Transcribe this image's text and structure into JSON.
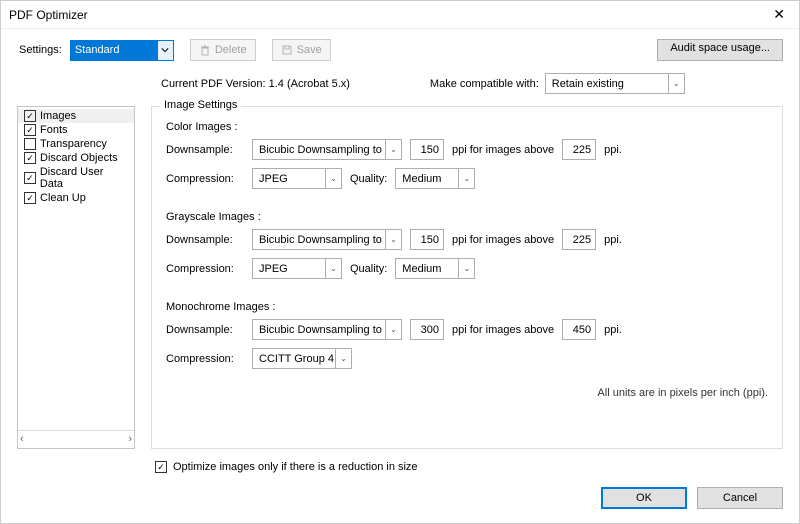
{
  "window": {
    "title": "PDF Optimizer"
  },
  "toolbar": {
    "settings_label": "Settings:",
    "settings_value": "Standard",
    "delete_label": "Delete",
    "save_label": "Save",
    "audit_label": "Audit space usage..."
  },
  "info": {
    "current_version": "Current PDF Version: 1.4 (Acrobat 5.x)",
    "compat_label": "Make compatible with:",
    "compat_value": "Retain existing"
  },
  "sidebar": {
    "items": [
      {
        "label": "Images",
        "checked": true,
        "selected": true
      },
      {
        "label": "Fonts",
        "checked": true
      },
      {
        "label": "Transparency",
        "checked": false
      },
      {
        "label": "Discard Objects",
        "checked": true
      },
      {
        "label": "Discard User Data",
        "checked": true
      },
      {
        "label": "Clean Up",
        "checked": true
      }
    ]
  },
  "panel": {
    "group_title": "Image Settings",
    "color": {
      "title": "Color Images :",
      "downsample_label": "Downsample:",
      "downsample_value": "Bicubic Downsampling to",
      "dpi": "150",
      "above_label": "ppi for images above",
      "above_dpi": "225",
      "ppi_suffix": "ppi.",
      "compression_label": "Compression:",
      "compression_value": "JPEG",
      "quality_label": "Quality:",
      "quality_value": "Medium"
    },
    "gray": {
      "title": "Grayscale Images :",
      "downsample_label": "Downsample:",
      "downsample_value": "Bicubic Downsampling to",
      "dpi": "150",
      "above_label": "ppi for images above",
      "above_dpi": "225",
      "ppi_suffix": "ppi.",
      "compression_label": "Compression:",
      "compression_value": "JPEG",
      "quality_label": "Quality:",
      "quality_value": "Medium"
    },
    "mono": {
      "title": "Monochrome Images :",
      "downsample_label": "Downsample:",
      "downsample_value": "Bicubic Downsampling to",
      "dpi": "300",
      "above_label": "ppi for images above",
      "above_dpi": "450",
      "ppi_suffix": "ppi.",
      "compression_label": "Compression:",
      "compression_value": "CCITT Group 4"
    },
    "footnote": "All units are in pixels per inch (ppi)."
  },
  "optimize": {
    "label": "Optimize images only if there is a reduction in size",
    "checked": true
  },
  "footer": {
    "ok": "OK",
    "cancel": "Cancel"
  }
}
